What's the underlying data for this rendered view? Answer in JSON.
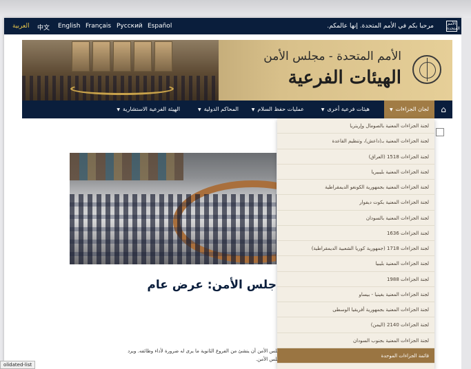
{
  "topbar": {
    "languages": [
      {
        "label": "العربية",
        "active": true
      },
      {
        "label": "中文"
      },
      {
        "label": "English"
      },
      {
        "label": "Français"
      },
      {
        "label": "Русский"
      },
      {
        "label": "Español"
      }
    ],
    "welcome": "مرحبا بكم في الأمم المتحدة. إنها عالمكم.",
    "logo_text": "الأمم المتحدة"
  },
  "banner": {
    "title_line1": "الأمم المتحدة - مجلس الأمن",
    "title_line2": "الهيئات الفرعية"
  },
  "nav": {
    "home_icon": "home-icon",
    "items": [
      {
        "label": "لجان الجزاءات",
        "active": true
      },
      {
        "label": "هيئات فرعية أخرى"
      },
      {
        "label": "عمليات حفظ السلام"
      },
      {
        "label": "المحاكم الدولية"
      },
      {
        "label": "الهيئة الفرعية الاستشارية"
      }
    ]
  },
  "dropdown": {
    "items": [
      "لجنة الجزاءات المعنية بالصومال وإريتريا",
      "لجنة الجزاءات المعنية بـ(داعش)، وتنظيم القاعدة",
      "لجنة الجزاءات 1518 (العراق)",
      "لجنة الجزاءات المعنية بليبيريا",
      "لجنة الجزاءات المعنية بجمهورية الكونغو الديمقراطية",
      "لجنة الجزاءات المعنية بكوت ديفوار",
      "لجنة الجزاءات المعنية بالسودان",
      "لجنة الجزاءات 1636",
      "لجنة الجزاءات 1718 (جمهورية كوريا الشعبية الديمقراطية)",
      "لجنة الجزاءات المعنية بليبيا",
      "لجنة الجزاءات 1988",
      "لجنة الجزاءات المعنية بغينيا - بيساو",
      "لجنة الجزاءات المعنية بجمهورية أفريقيا الوسطى",
      "لجنة الجزاءات 2140 (اليمن)",
      "لجنة الجزاءات المعنية بجنوب السودان",
      "قائمة الجزاءات الموحدة"
    ],
    "highlighted_index": 15
  },
  "main": {
    "heading": "جلس الأمن: عرض عام",
    "body_line1": "جلس الأمن أن ينشئ من الفروع الثانوية ما يرى له ضرورة لأداء وظائفه. ويرد",
    "body_line2": "جلس الأمن."
  },
  "status_url": "olidated-list",
  "colors": {
    "navy": "#0a1e3c",
    "gold": "#a17c45",
    "dropdown_bg": "#f3eee4"
  }
}
